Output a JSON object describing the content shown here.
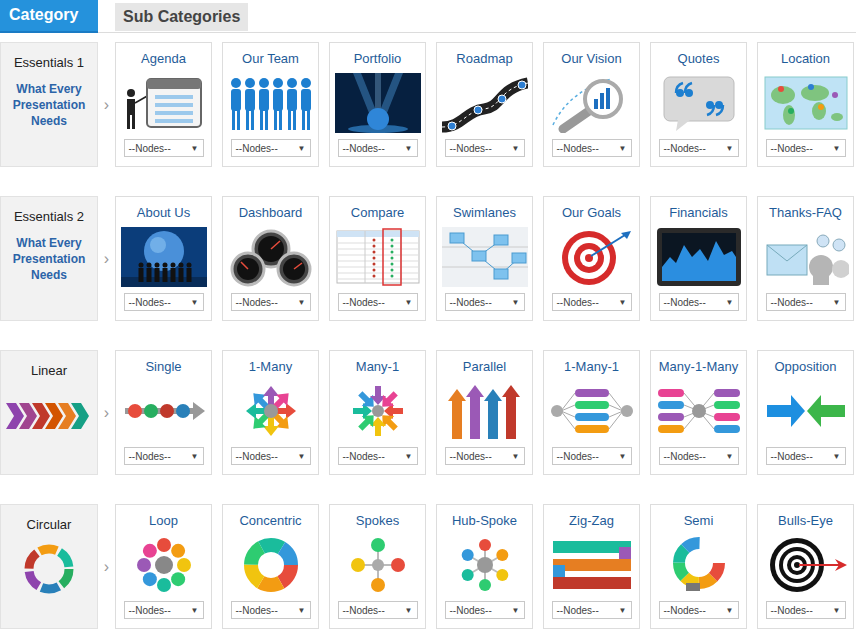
{
  "tabs": [
    {
      "label": "Category",
      "selected": true
    },
    {
      "label": "Sub Categories",
      "selected": false
    }
  ],
  "row_arrow": "›",
  "dropdown_arrow": "▼",
  "categories": [
    {
      "name": "Essentials 1",
      "subtitle": "What Every Presentation Needs",
      "subcategories": [
        {
          "title": "Agenda",
          "value": "--Nodes--"
        },
        {
          "title": "Our Team",
          "value": "--Nodes--"
        },
        {
          "title": "Portfolio",
          "value": "--Nodes--"
        },
        {
          "title": "Roadmap",
          "value": "--Nodes--"
        },
        {
          "title": "Our Vision",
          "value": "--Nodes--"
        },
        {
          "title": "Quotes",
          "value": "--Nodes--"
        },
        {
          "title": "Location",
          "value": "--Nodes--"
        }
      ]
    },
    {
      "name": "Essentials 2",
      "subtitle": "What Every Presentation Needs",
      "subcategories": [
        {
          "title": "About Us",
          "value": "--Nodes--"
        },
        {
          "title": "Dashboard",
          "value": "--Nodes--"
        },
        {
          "title": "Compare",
          "value": "--Nodes--"
        },
        {
          "title": "Swimlanes",
          "value": "--Nodes--"
        },
        {
          "title": "Our Goals",
          "value": "--Nodes--"
        },
        {
          "title": "Financials",
          "value": "--Nodes--"
        },
        {
          "title": "Thanks-FAQ",
          "value": "--Nodes--"
        }
      ]
    },
    {
      "name": "Linear",
      "subcategories": [
        {
          "title": "Single",
          "value": "--Nodes--"
        },
        {
          "title": "1-Many",
          "value": "--Nodes--"
        },
        {
          "title": "Many-1",
          "value": "--Nodes--"
        },
        {
          "title": "Parallel",
          "value": "--Nodes--"
        },
        {
          "title": "1-Many-1",
          "value": "--Nodes--"
        },
        {
          "title": "Many-1-Many",
          "value": "--Nodes--"
        },
        {
          "title": "Opposition",
          "value": "--Nodes--"
        }
      ]
    },
    {
      "name": "Circular",
      "subcategories": [
        {
          "title": "Loop",
          "value": "--Nodes--"
        },
        {
          "title": "Concentric",
          "value": "--Nodes--"
        },
        {
          "title": "Spokes",
          "value": "--Nodes--"
        },
        {
          "title": "Hub-Spoke",
          "value": "--Nodes--"
        },
        {
          "title": "Zig-Zag",
          "value": "--Nodes--"
        },
        {
          "title": "Semi",
          "value": "--Nodes--"
        },
        {
          "title": "Bulls-Eye",
          "value": "--Nodes--"
        }
      ]
    }
  ]
}
